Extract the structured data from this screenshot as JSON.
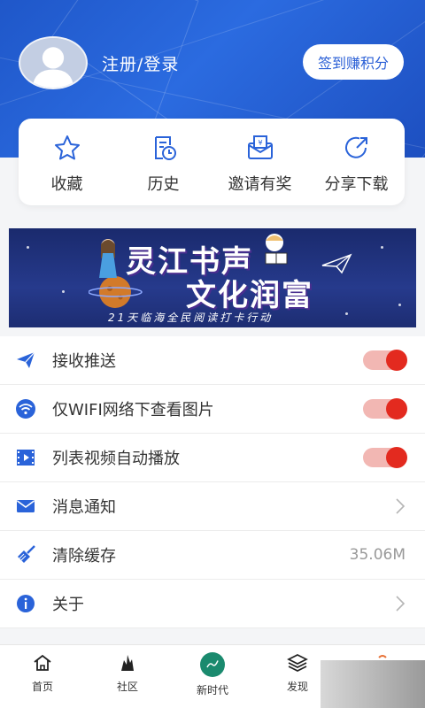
{
  "header": {
    "login_text": "注册/登录",
    "signin_button": "签到赚积分"
  },
  "quick_actions": [
    {
      "label": "收藏",
      "icon": "star-icon"
    },
    {
      "label": "历史",
      "icon": "history-icon"
    },
    {
      "label": "邀请有奖",
      "icon": "invite-icon"
    },
    {
      "label": "分享下载",
      "icon": "share-icon"
    }
  ],
  "banner": {
    "title_line1": "灵江书声",
    "title_line2": "文化润富",
    "subtitle": "21天临海全民阅读打卡行动"
  },
  "settings": [
    {
      "label": "接收推送",
      "icon": "send-icon",
      "type": "toggle",
      "on": true
    },
    {
      "label": "仅WIFI网络下查看图片",
      "icon": "wifi-icon",
      "type": "toggle",
      "on": true
    },
    {
      "label": "列表视频自动播放",
      "icon": "video-icon",
      "type": "toggle",
      "on": true
    },
    {
      "label": "消息通知",
      "icon": "mail-icon",
      "type": "chevron"
    },
    {
      "label": "清除缓存",
      "icon": "broom-icon",
      "type": "value",
      "value": "35.06M"
    },
    {
      "label": "关于",
      "icon": "info-icon",
      "type": "chevron"
    }
  ],
  "tabbar": [
    {
      "label": "首页",
      "icon": "home-icon"
    },
    {
      "label": "社区",
      "icon": "community-icon"
    },
    {
      "label": "新时代",
      "icon": "new-era-icon"
    },
    {
      "label": "发现",
      "icon": "discover-icon"
    }
  ],
  "colors": {
    "brand_blue": "#2a63d9",
    "toggle_on": "#e32a1f",
    "toggle_track": "#f2b7b3"
  }
}
